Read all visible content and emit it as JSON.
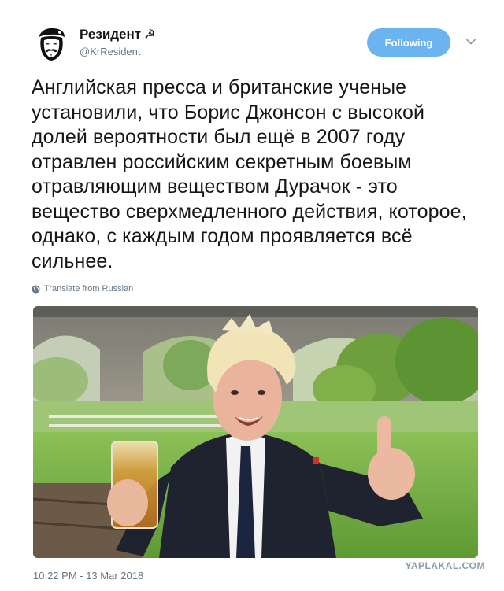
{
  "header": {
    "display_name": "Резидент",
    "name_symbol": "☭",
    "handle": "@KrResident",
    "follow_label": "Following"
  },
  "tweet": {
    "text": "Английская пресса и британские ученые установили, что Борис Джонсон с высокой долей вероятности был ещё в 2007 году отравлен российским секретным боевым отравляющим веществом Дурачок - это вещество сверхмедленного действия, которое, однако, с каждым годом проявляется всё сильнее.",
    "translate_label": "Translate from Russian",
    "timestamp": "10:22 PM - 13 Mar 2018"
  },
  "watermark": "YAPLAKAL.COM",
  "colors": {
    "follow_button": "#6cb4f0",
    "secondary_text": "#657786",
    "primary_text": "#14171a"
  },
  "icons": {
    "caret": "chevron-down-icon",
    "translate": "globe-icon",
    "avatar": "mask-avatar-icon"
  }
}
